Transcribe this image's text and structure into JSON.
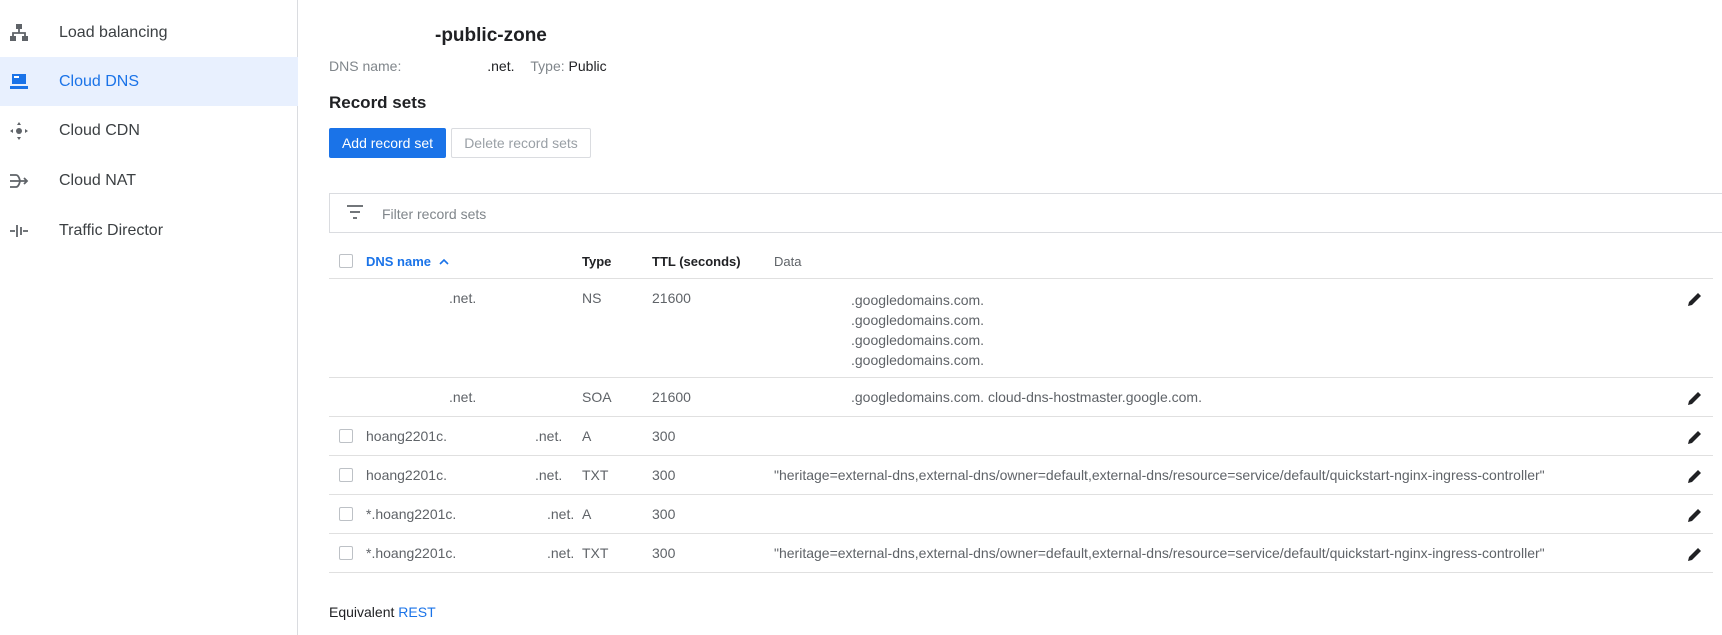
{
  "sidebar": {
    "items": [
      {
        "label": "Load balancing",
        "icon": "load-balancing-icon",
        "active": false
      },
      {
        "label": "Cloud DNS",
        "icon": "cloud-dns-icon",
        "active": true
      },
      {
        "label": "Cloud CDN",
        "icon": "cloud-cdn-icon",
        "active": false
      },
      {
        "label": "Cloud NAT",
        "icon": "cloud-nat-icon",
        "active": false
      },
      {
        "label": "Traffic Director",
        "icon": "traffic-director-icon",
        "active": false
      }
    ]
  },
  "zone": {
    "title": "-public-zone",
    "dns_name_label": "DNS name:",
    "dns_name_value": ".net.",
    "type_label": "Type:",
    "type_value": "Public"
  },
  "record_sets": {
    "title": "Record sets",
    "add_button": "Add record set",
    "delete_button": "Delete record sets",
    "filter_placeholder": "Filter record sets",
    "columns": {
      "dns_name": "DNS name",
      "type": "Type",
      "ttl": "TTL (seconds)",
      "data": "Data"
    },
    "rows": [
      {
        "dns_name": ".net.",
        "type": "NS",
        "ttl": "21600",
        "data": [
          ".googledomains.com.",
          ".googledomains.com.",
          ".googledomains.com.",
          ".googledomains.com."
        ],
        "checkbox": false
      },
      {
        "dns_name": ".net.",
        "type": "SOA",
        "ttl": "21600",
        "data": [
          ".googledomains.com. cloud-dns-hostmaster.google.com."
        ],
        "checkbox": false
      },
      {
        "dns_name": "hoang2201c.",
        "dns_name_suffix": ".net.",
        "type": "A",
        "ttl": "300",
        "data": [
          ""
        ],
        "checkbox": true
      },
      {
        "dns_name": "hoang2201c.",
        "dns_name_suffix": ".net.",
        "type": "TXT",
        "ttl": "300",
        "data": [
          "\"heritage=external-dns,external-dns/owner=default,external-dns/resource=service/default/quickstart-nginx-ingress-controller\""
        ],
        "checkbox": true
      },
      {
        "dns_name": "*.hoang2201c.",
        "dns_name_suffix": ".net.",
        "type": "A",
        "ttl": "300",
        "data": [
          ""
        ],
        "checkbox": true
      },
      {
        "dns_name": "*.hoang2201c.",
        "dns_name_suffix": ".net.",
        "type": "TXT",
        "ttl": "300",
        "data": [
          "\"heritage=external-dns,external-dns/owner=default,external-dns/resource=service/default/quickstart-nginx-ingress-controller\""
        ],
        "checkbox": true
      }
    ]
  },
  "footer": {
    "equivalent_label": "Equivalent",
    "rest_link": "REST"
  },
  "colors": {
    "accent": "#1a73e8",
    "active_bg": "#e8f0fe",
    "border": "#dadce0"
  }
}
